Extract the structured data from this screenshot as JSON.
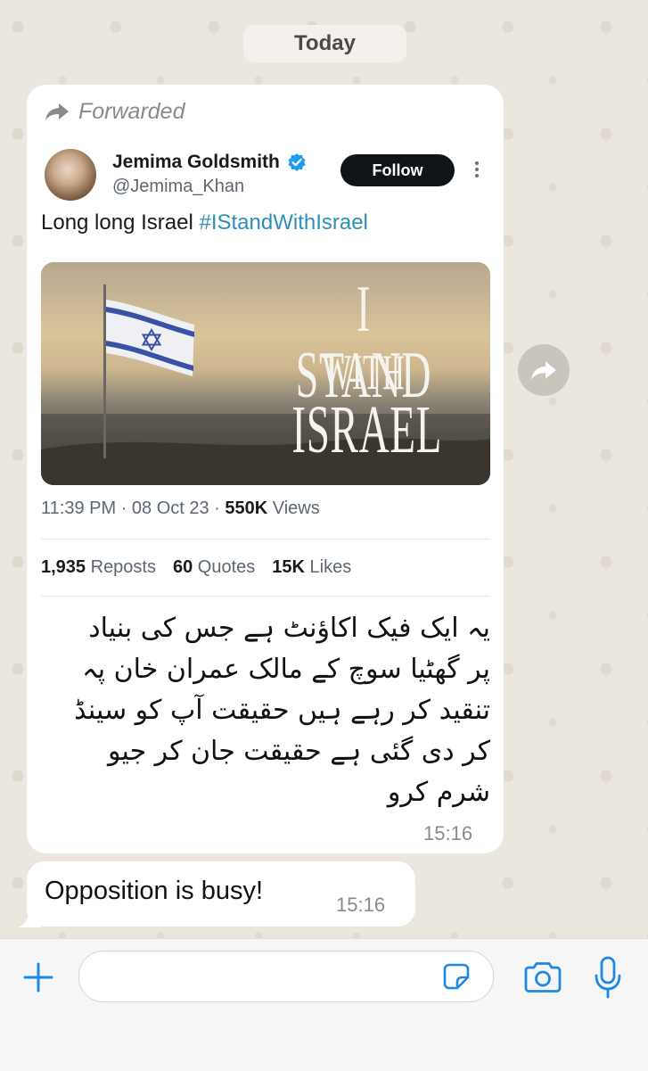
{
  "chat": {
    "date_separator": "Today"
  },
  "message1": {
    "forwarded_label": "Forwarded",
    "tweet": {
      "author_name": "Jemima Goldsmith",
      "handle": "@Jemima_Khan",
      "follow_label": "Follow",
      "text_plain": "Long long Israel ",
      "hashtag": "#IStandWithIsrael",
      "image_text_line1": "I STAND",
      "image_text_line2": "WITH",
      "image_text_line3": "ISRAEL",
      "timestamp": "11:39 PM · 08 Oct 23 · ",
      "views_count": "550K",
      "views_label": " Views",
      "reposts_count": "1,935",
      "reposts_label": " Reposts",
      "quotes_count": "60",
      "quotes_label": " Quotes",
      "likes_count": "15K",
      "likes_label": " Likes"
    },
    "urdu_lines": [
      "یہ ایک فیک اکاؤنٹ ہے جس کی بنیاد",
      "پر گھٹیا سوچ کے مالک عمران خان پہ",
      "تنقید کر رہے ہیں حقیقت آپ کو سینڈ",
      "کر دی گئی ہے حقیقت جان کر جیو",
      "شرم کرو"
    ],
    "time": "15:16"
  },
  "message2": {
    "text": "Opposition is busy!",
    "time": "15:16"
  },
  "composer": {
    "placeholder": ""
  },
  "icons": {
    "forward": "forward-arrow-icon",
    "verified": "verified-badge-icon",
    "share": "share-icon",
    "add": "plus-icon",
    "sticker": "sticker-icon",
    "camera": "camera-icon",
    "microphone": "microphone-icon"
  },
  "colors": {
    "accent_blue": "#1e88e5",
    "hashtag": "#2e8fb8",
    "follow_button": "#0f1419"
  }
}
